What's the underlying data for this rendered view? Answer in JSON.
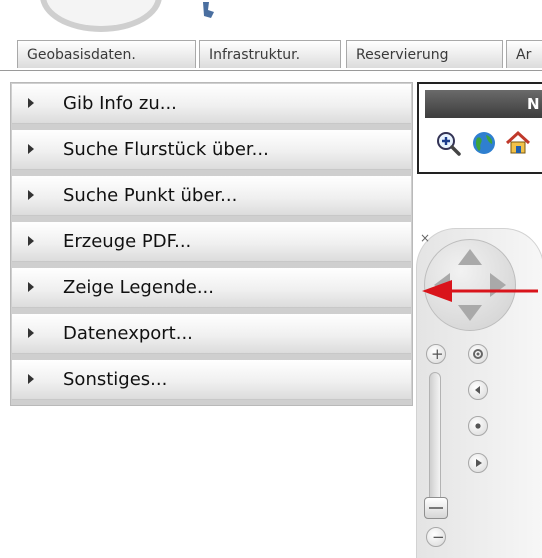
{
  "tabs": [
    {
      "label": "Geobasisdaten."
    },
    {
      "label": "Infrastruktur."
    },
    {
      "label": "Reservierung"
    },
    {
      "label": "Ar"
    }
  ],
  "menu": {
    "items": [
      {
        "label": "Gib Info zu..."
      },
      {
        "label": "Suche Flurstück über..."
      },
      {
        "label": "Suche Punkt über..."
      },
      {
        "label": "Erzeuge PDF..."
      },
      {
        "label": "Zeige Legende..."
      },
      {
        "label": "Datenexport..."
      },
      {
        "label": "Sonstiges..."
      }
    ]
  },
  "map_toolbar": {
    "title": "N",
    "icons": [
      "zoom-in-icon",
      "globe-icon",
      "home-icon"
    ]
  },
  "nav_widget": {
    "close_glyph": "×",
    "zoom_in_glyph": "+",
    "zoom_out_glyph": "−"
  },
  "colors": {
    "annotation_arrow": "#d9141b",
    "toolbar_title_bg": "#4a4a4a"
  }
}
